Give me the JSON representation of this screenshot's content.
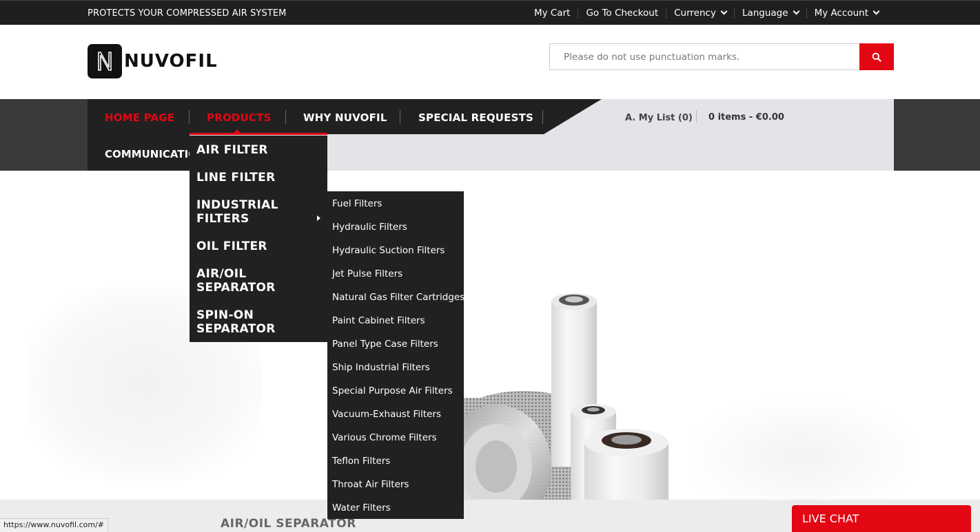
{
  "topbar": {
    "tagline": "PROTECTS YOUR COMPRESSED AIR SYSTEM",
    "links": [
      {
        "label": "My Cart"
      },
      {
        "label": "Go To Checkout"
      },
      {
        "label": "Currency"
      },
      {
        "label": "Language"
      },
      {
        "label": "My Account"
      }
    ]
  },
  "brand": {
    "name": "NUVOFIL",
    "logo_letter": "N"
  },
  "search": {
    "placeholder": "Please do not use punctuation marks."
  },
  "nav": {
    "items": [
      "HOME PAGE",
      "PRODUCTS",
      "WHY NUVOFIL",
      "SPECIAL REQUESTS"
    ],
    "second_row": "COMMUNICATION",
    "my_list": "A. My List (0)",
    "cart_summary": "0 items - €0.00"
  },
  "products_menu": [
    "AIR FILTER",
    "LINE FILTER",
    "INDUSTRIAL FILTERS",
    "OIL FILTER",
    "AIR/OIL SEPARATOR",
    "SPIN-ON SEPARATOR"
  ],
  "industrial_submenu": [
    "Fuel Filters",
    "Hydraulic Filters",
    "Hydraulic Suction Filters",
    "Jet Pulse Filters",
    "Natural Gas Filter Cartridges",
    "Paint Cabinet Filters",
    "Panel Type Case Filters",
    "Ship Industrial Filters",
    "Special Purpose Air Filters",
    "Vacuum-Exhaust Filters",
    "Various Chrome Filters",
    "Teflon Filters",
    "Throat Air Filters",
    "Water Filters"
  ],
  "hero": {
    "band_label": "AIR/OIL SEPARATOR"
  },
  "status_url": "https://www.nuvofil.com/#",
  "live_chat": "LIVE CHAT",
  "colors": {
    "accent": "#e30613",
    "dark": "#212121",
    "topbar": "#1f1f1f",
    "panel": "#e3e4e8"
  }
}
